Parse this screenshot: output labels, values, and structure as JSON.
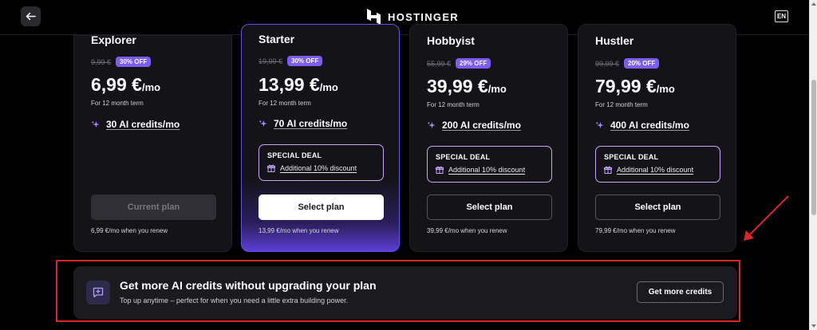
{
  "header": {
    "brand": "HOSTINGER",
    "language": "EN"
  },
  "plans": [
    {
      "name": "Explorer",
      "old_price": "9,99 €",
      "discount": "30% OFF",
      "price": "6,99 €",
      "per": "/mo",
      "term": "For 12 month term",
      "credits": "30 AI credits/mo",
      "button": "Current plan",
      "renew": "6,99 €/mo when you renew"
    },
    {
      "name": "Starter",
      "old_price": "19,99 €",
      "discount": "30% OFF",
      "price": "13,99 €",
      "per": "/mo",
      "term": "For 12 month term",
      "credits": "70 AI credits/mo",
      "deal_title": "SPECIAL DEAL",
      "deal_text": "Additional 10% discount",
      "button": "Select plan",
      "renew": "13,99 €/mo when you renew"
    },
    {
      "name": "Hobbyist",
      "old_price": "55,99 €",
      "discount": "29% OFF",
      "price": "39,99 €",
      "per": "/mo",
      "term": "For 12 month term",
      "credits": "200 AI credits/mo",
      "deal_title": "SPECIAL DEAL",
      "deal_text": "Additional 10% discount",
      "button": "Select plan",
      "renew": "39,99 €/mo when you renew"
    },
    {
      "name": "Hustler",
      "old_price": "99,99 €",
      "discount": "20% OFF",
      "price": "79,99 €",
      "per": "/mo",
      "term": "For 12 month term",
      "credits": "400 AI credits/mo",
      "deal_title": "SPECIAL DEAL",
      "deal_text": "Additional 10% discount",
      "button": "Select plan",
      "renew": "79,99 €/mo when you renew"
    }
  ],
  "banner": {
    "title": "Get more AI credits without upgrading your plan",
    "subtitle": "Top up anytime – perfect for when you need a little extra building power.",
    "button": "Get more credits"
  },
  "colors": {
    "accent": "#7c5cf5",
    "annotation": "#d92626"
  }
}
